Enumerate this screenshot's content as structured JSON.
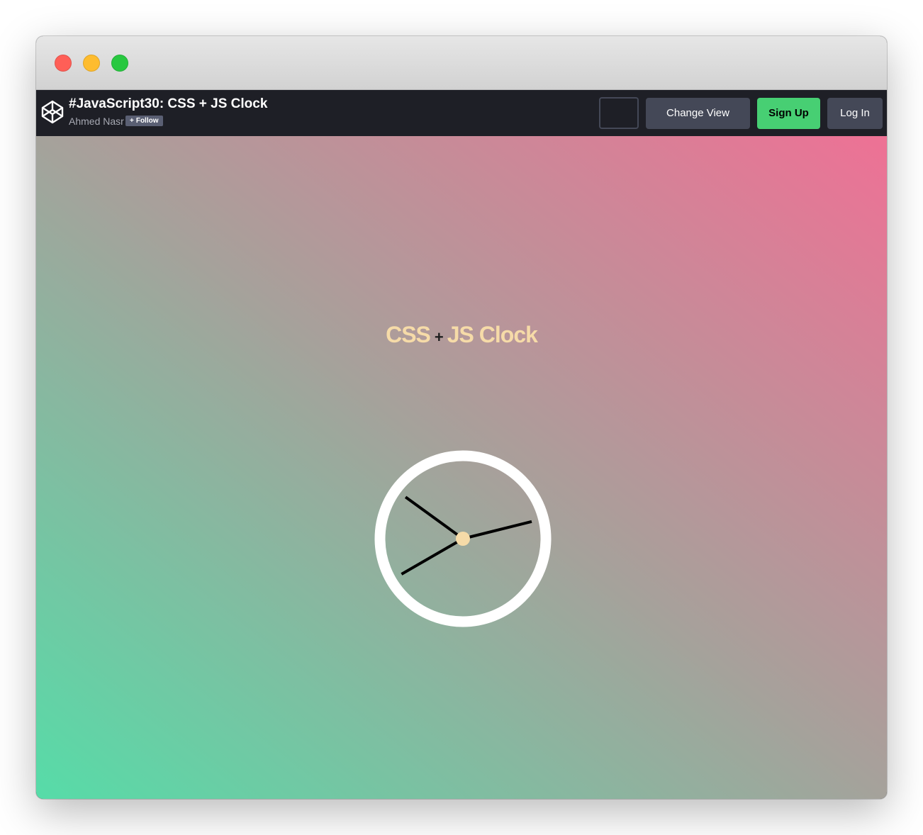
{
  "header": {
    "pen_title": "#JavaScript30: CSS + JS Clock",
    "author": "Ahmed Nasr",
    "follow_label": "Follow",
    "follow_plus": "+",
    "change_view_label": "Change View",
    "signup_label": "Sign Up",
    "login_label": "Log In"
  },
  "preview": {
    "heading_left": "CSS",
    "heading_plus": "+",
    "heading_right": "JS Clock"
  },
  "clock": {
    "hour": 10,
    "minute": 12,
    "second": 40
  },
  "colors": {
    "header_bg": "#1e1f26",
    "signup_green": "#47cf73",
    "button_gray": "#444857",
    "heading_color": "#f6dba8",
    "gradient_bottom_left": "#56dca8",
    "gradient_middle": "#a5a29b",
    "gradient_top_right": "#ee7195",
    "clock_face": "#ffffff",
    "hand_color": "#000000",
    "center_dot": "#f6dba8"
  }
}
